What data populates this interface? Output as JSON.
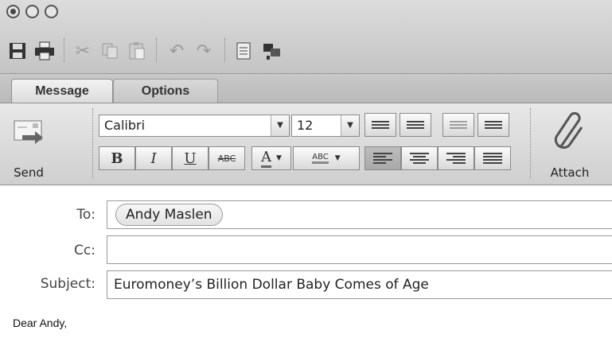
{
  "toolbar": {
    "icons": [
      "save-icon",
      "print-icon",
      "cut-icon",
      "copy-icon",
      "paste-icon",
      "undo-icon",
      "redo-icon",
      "address-book-icon",
      "check-names-icon"
    ]
  },
  "tabs": [
    {
      "label": "Message",
      "active": true
    },
    {
      "label": "Options",
      "active": false
    }
  ],
  "ribbon": {
    "send_label": "Send",
    "attach_label": "Attach",
    "font_name": "Calibri",
    "font_size": "12",
    "bold": "B",
    "italic": "I",
    "underline": "U",
    "strikethrough": "ABC",
    "font_color": "A",
    "highlight": "ABC"
  },
  "header": {
    "to_label": "To:",
    "to_recipient": "Andy Maslen",
    "cc_label": "Cc:",
    "cc_value": "",
    "subject_label": "Subject:",
    "subject_value": "Euromoney’s Billion Dollar Baby Comes of Age"
  },
  "body": {
    "greeting": "Dear Andy,"
  }
}
